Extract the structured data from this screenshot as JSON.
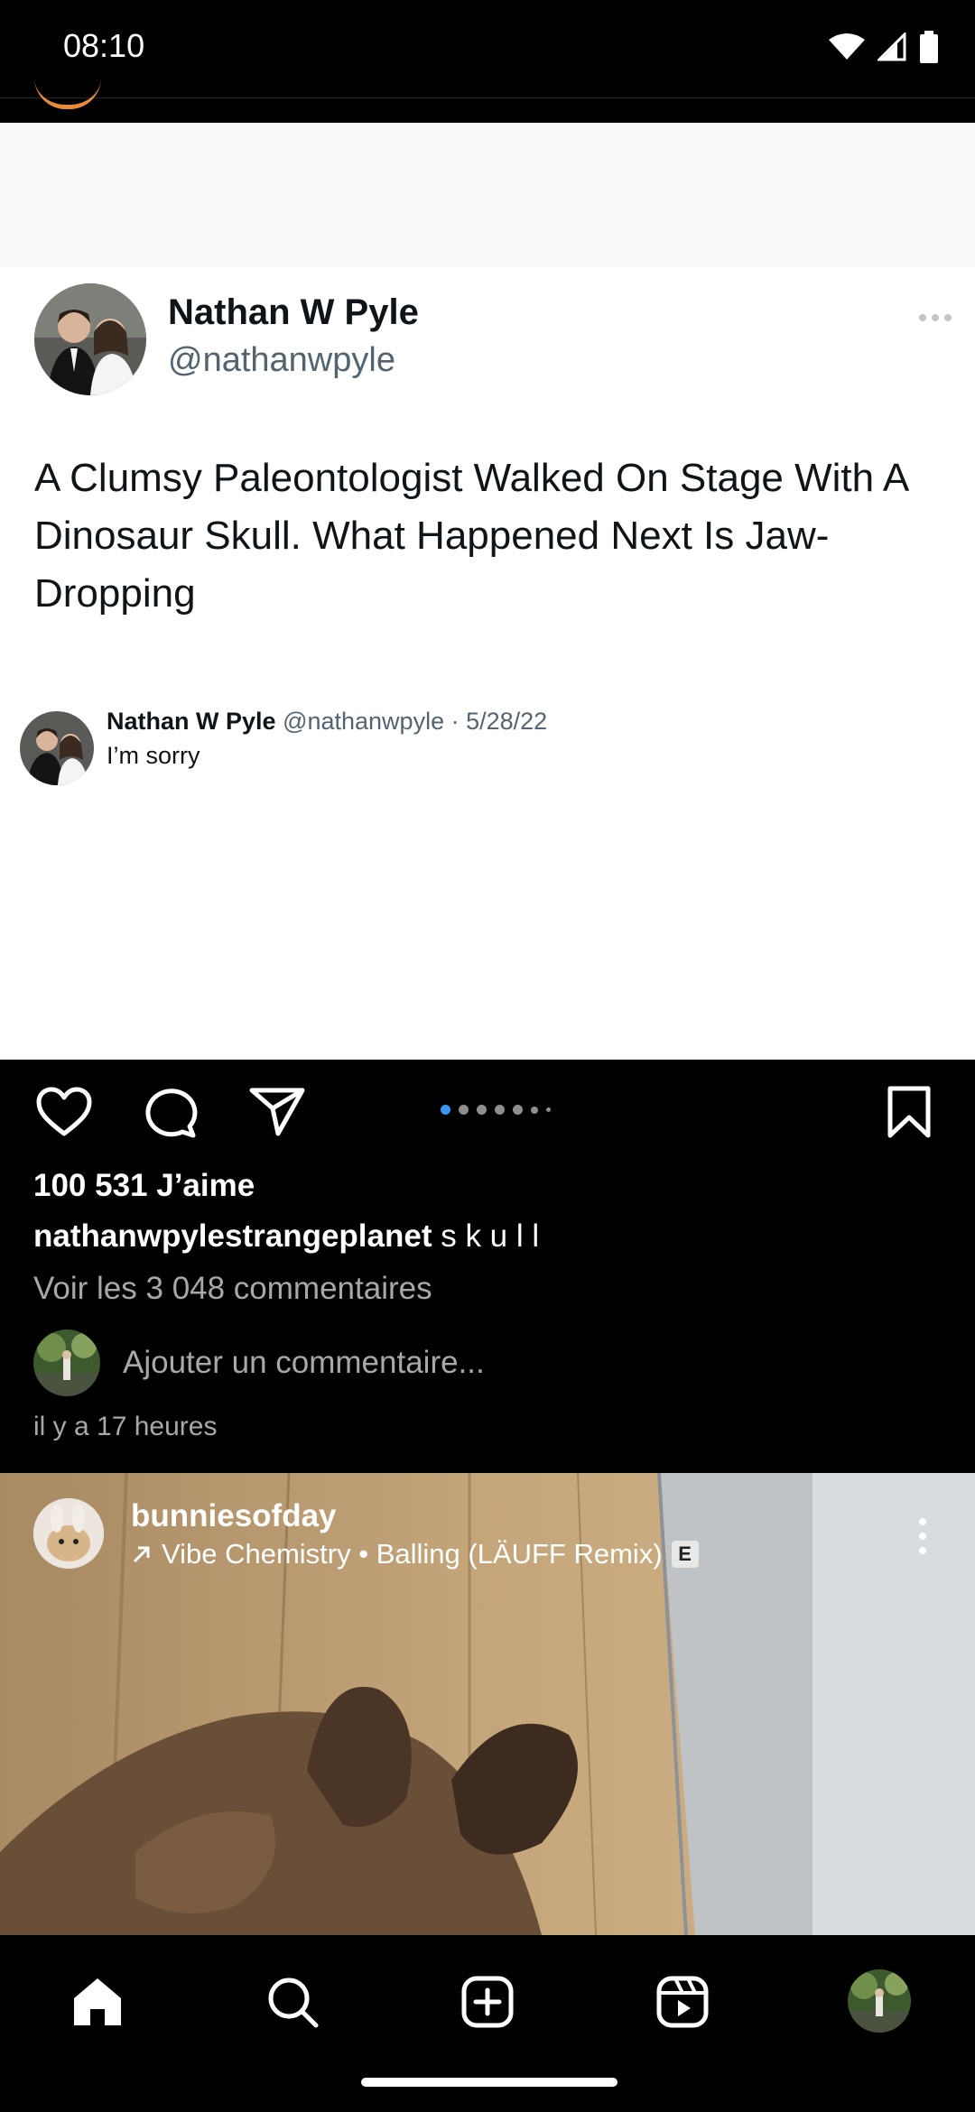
{
  "status_bar": {
    "time": "08:10"
  },
  "post": {
    "tweet": {
      "name": "Nathan W Pyle",
      "handle": "@nathanwpyle",
      "text": "A Clumsy Paleontologist Walked On Stage With A Dinosaur Skull. What Happened Next Is Jaw-Dropping",
      "quote": {
        "name": "Nathan W Pyle",
        "meta": "@nathanwpyle · 5/28/22",
        "text": "I’m sorry"
      }
    },
    "carousel": {
      "count": 7,
      "active_index": 0
    },
    "likes": "100 531 J’aime",
    "caption_user": "nathanwpylestrangeplanet",
    "caption_text": "s k u l l",
    "view_comments": "Voir les 3 048 commentaires",
    "add_comment_placeholder": "Ajouter un commentaire...",
    "time_ago": "il y a 17 heures"
  },
  "post2": {
    "username": "bunniesofday",
    "audio": "Vibe Chemistry • Balling (LÄUFF Remix)",
    "explicit_badge": "E"
  },
  "icons": {
    "like": "heart-icon",
    "comment": "comment-icon",
    "share": "send-icon",
    "save": "bookmark-icon",
    "more": "more-icon",
    "home": "home-icon",
    "search": "search-icon",
    "create": "create-icon",
    "reels": "reels-icon"
  },
  "colors": {
    "background": "#000000",
    "accent_blue": "#3897f0",
    "muted_text": "#a8a8a8",
    "tweet_handle": "#536471"
  }
}
